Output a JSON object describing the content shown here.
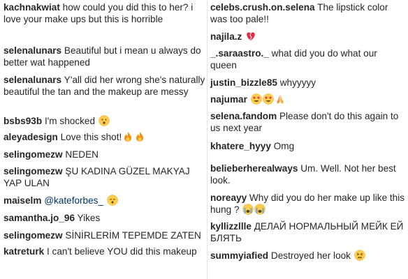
{
  "left_comments": [
    {
      "user": "kachnakwiat",
      "text": "how could you did this to her? i love your make ups but this is horrible"
    },
    {
      "user": "selenalunars",
      "text": "Beautiful but i mean u always do better wat happened"
    },
    {
      "user": "selenalunars",
      "text": "Y'all did her wrong she's naturally beautiful the tan and the makeup are messy"
    },
    {
      "user": "bsbs93b",
      "text": "I'm shocked"
    },
    {
      "user": "aleyadesign",
      "text": "Love this shot!"
    },
    {
      "user": "selingomezw",
      "text": "NEDEN"
    },
    {
      "user": "selingomezw",
      "text": "ŞU KADINA GÜZEL MAKYAJ YAP ULAN"
    },
    {
      "user": "maiselm",
      "text": "",
      "mention": "@kateforbes_"
    },
    {
      "user": "samantha.jo_96",
      "text": "Yikes"
    },
    {
      "user": "selingomezw",
      "text": "SİNİRLERİM TEPEMDE ZATEN"
    },
    {
      "user": "katreturk",
      "text": "I can't believe YOU did this makeup"
    }
  ],
  "right_comments": [
    {
      "user": "celebs.crush.on.selena",
      "text": "The lipstick color was too pale!!"
    },
    {
      "user": "najila.z",
      "text": ""
    },
    {
      "user": "_.saraastro._",
      "text": "what did you do what our queen"
    },
    {
      "user": "justin_bizzle85",
      "text": "whyyyyy"
    },
    {
      "user": "najumar",
      "text": ""
    },
    {
      "user": "selena.fandom",
      "text": "Please don't do this again to us next year"
    },
    {
      "user": "khatere_hyyy",
      "text": "Omg"
    },
    {
      "user": "belieberherealways",
      "text": "Um. Well. Not her best look."
    },
    {
      "user": "noreayy",
      "text": "Why did you do her make up like this hung ?"
    },
    {
      "user": "kyllizzllle",
      "text": "ДЕЛАЙ НОРМАЛЬНЫЙ МЕЙК ЕЙ БЛЯТЬ"
    },
    {
      "user": "summyiafied",
      "text": "Destroyed her look"
    }
  ],
  "emoji_icons": {
    "shocked": "hushed-face-icon",
    "fire": "fire-icon",
    "sleepy": "sleepy-face-icon",
    "heart": "broken-heart-icon",
    "heart_eyes": "heart-eyes-icon",
    "pray": "folded-hands-icon",
    "crying": "crying-face-icon",
    "angry": "persevering-face-icon"
  }
}
